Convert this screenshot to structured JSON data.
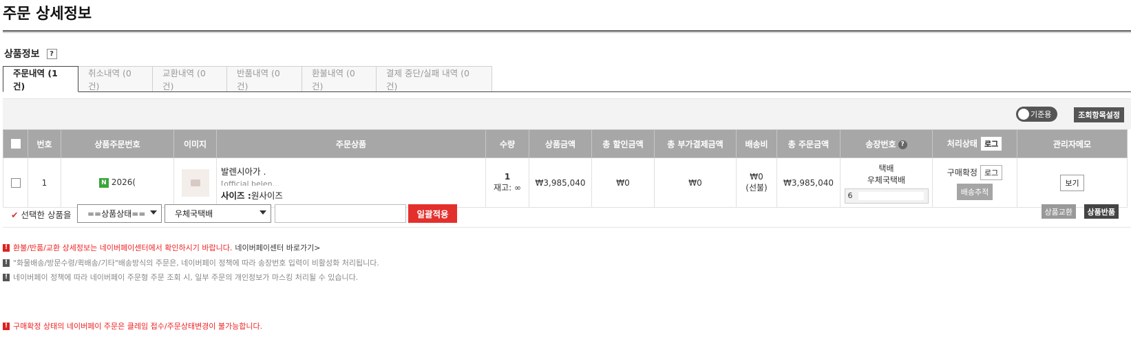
{
  "page_title": "주문 상세정보",
  "section": {
    "title": "상품정보",
    "help": "?"
  },
  "tabs": [
    {
      "label": "주문내역 (1 건)",
      "active": true
    },
    {
      "label": "취소내역 (0 건)"
    },
    {
      "label": "교환내역 (0 건)"
    },
    {
      "label": "반품내역 (0 건)"
    },
    {
      "label": "환불내역 (0 건)"
    },
    {
      "label": "결제 중단/실패 내역 (0 건)"
    }
  ],
  "toolbar": {
    "toggle_label": "기준용",
    "settings_label": "조회항목설정"
  },
  "table": {
    "headers": {
      "no": "번호",
      "product_order_no": "상품주문번호",
      "image": "이미지",
      "product": "주문상품",
      "qty": "수량",
      "price": "상품금액",
      "discount": "총 할인금액",
      "extra_pay": "총 부가결제금액",
      "shipping_fee": "배송비",
      "total": "총 주문금액",
      "tracking": "송장번호",
      "tracking_help": "?",
      "status": "처리상태",
      "status_log": "로그",
      "memo": "관리자메모"
    },
    "row": {
      "no": "1",
      "naver_badge": "N",
      "product_order_no": "2026(",
      "product_name": "발렌시아가 .",
      "product_sub": "[official belen...",
      "option_label": "사이즈 :",
      "option_value": "원사이즈",
      "qty": "1",
      "stock": "재고: ∞",
      "price": "₩3,985,040",
      "discount": "₩0",
      "extra_pay": "₩0",
      "shipping_fee": "₩0",
      "shipping_type": "(선불)",
      "total": "₩3,985,040",
      "ship_method": "택배",
      "carrier": "우체국택배",
      "tracking_no": "6",
      "status": "구매확정",
      "status_log": "로그",
      "track_btn": "배송추적",
      "memo_btn": "보기"
    }
  },
  "bulk": {
    "label": "선택한 상품을",
    "status_select": "==상품상태==",
    "carrier_select": "우체국택배",
    "apply": "일괄적용",
    "exchange": "상품교환",
    "return": "상품반품"
  },
  "notices": {
    "n1": "환불/반품/교환 상세정보는 네이버페이센터에서 확인하시기 바랍니다.",
    "n1_link": "네이버페이센터 바로가기>",
    "n2": "\"화물배송/방문수령/퀵배송/기타\"배송방식의 주문은, 네이버페이 정책에 따라 송장번호 입력이 비활성화 처리됩니다.",
    "n3": "네이버페이 정책에 따라 네이버페이 주문형 주문 조회 시, 일부 주문의 개인정보가 마스킹 처리될 수 있습니다.",
    "n4": "구매확정 상태의 네이버페이 주문은 클레임 접수/주문상태변경이 불가능합니다."
  },
  "colors": {
    "accent_red": "#e3302d",
    "header_gray": "#a7a7a7",
    "naver_green": "#3aa53a"
  }
}
